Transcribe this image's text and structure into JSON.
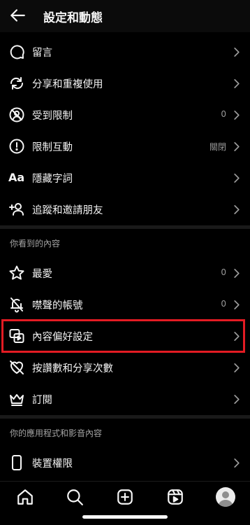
{
  "header": {
    "title": "設定和動態"
  },
  "items": [
    {
      "label": "留言",
      "value": ""
    },
    {
      "label": "分享和重複使用",
      "value": ""
    },
    {
      "label": "受到限制",
      "value": "0"
    },
    {
      "label": "限制互動",
      "value": "關閉"
    },
    {
      "label": "隱藏字詞",
      "value": "",
      "icon_text": "Aa"
    },
    {
      "label": "追蹤和邀請朋友",
      "value": ""
    }
  ],
  "section_what_you_see": {
    "title": "你看到的內容",
    "items": [
      {
        "label": "最愛",
        "value": "0"
      },
      {
        "label": "噤聲的帳號",
        "value": "0"
      },
      {
        "label": "內容偏好設定",
        "value": ""
      },
      {
        "label": "按讚數和分享次數",
        "value": ""
      },
      {
        "label": "訂閱",
        "value": ""
      }
    ]
  },
  "section_apps_media": {
    "title": "你的應用程式和影音內容",
    "items": [
      {
        "label": "裝置權限",
        "value": ""
      }
    ]
  },
  "highlight": {
    "target": "內容偏好設定",
    "color": "#e31b23"
  },
  "theme": {
    "background": "#000000",
    "text": "#f5f5f5",
    "muted": "#9a9a9a"
  },
  "bottom_nav": [
    "home-icon",
    "search-icon",
    "create-icon",
    "reels-icon",
    "profile-avatar"
  ]
}
